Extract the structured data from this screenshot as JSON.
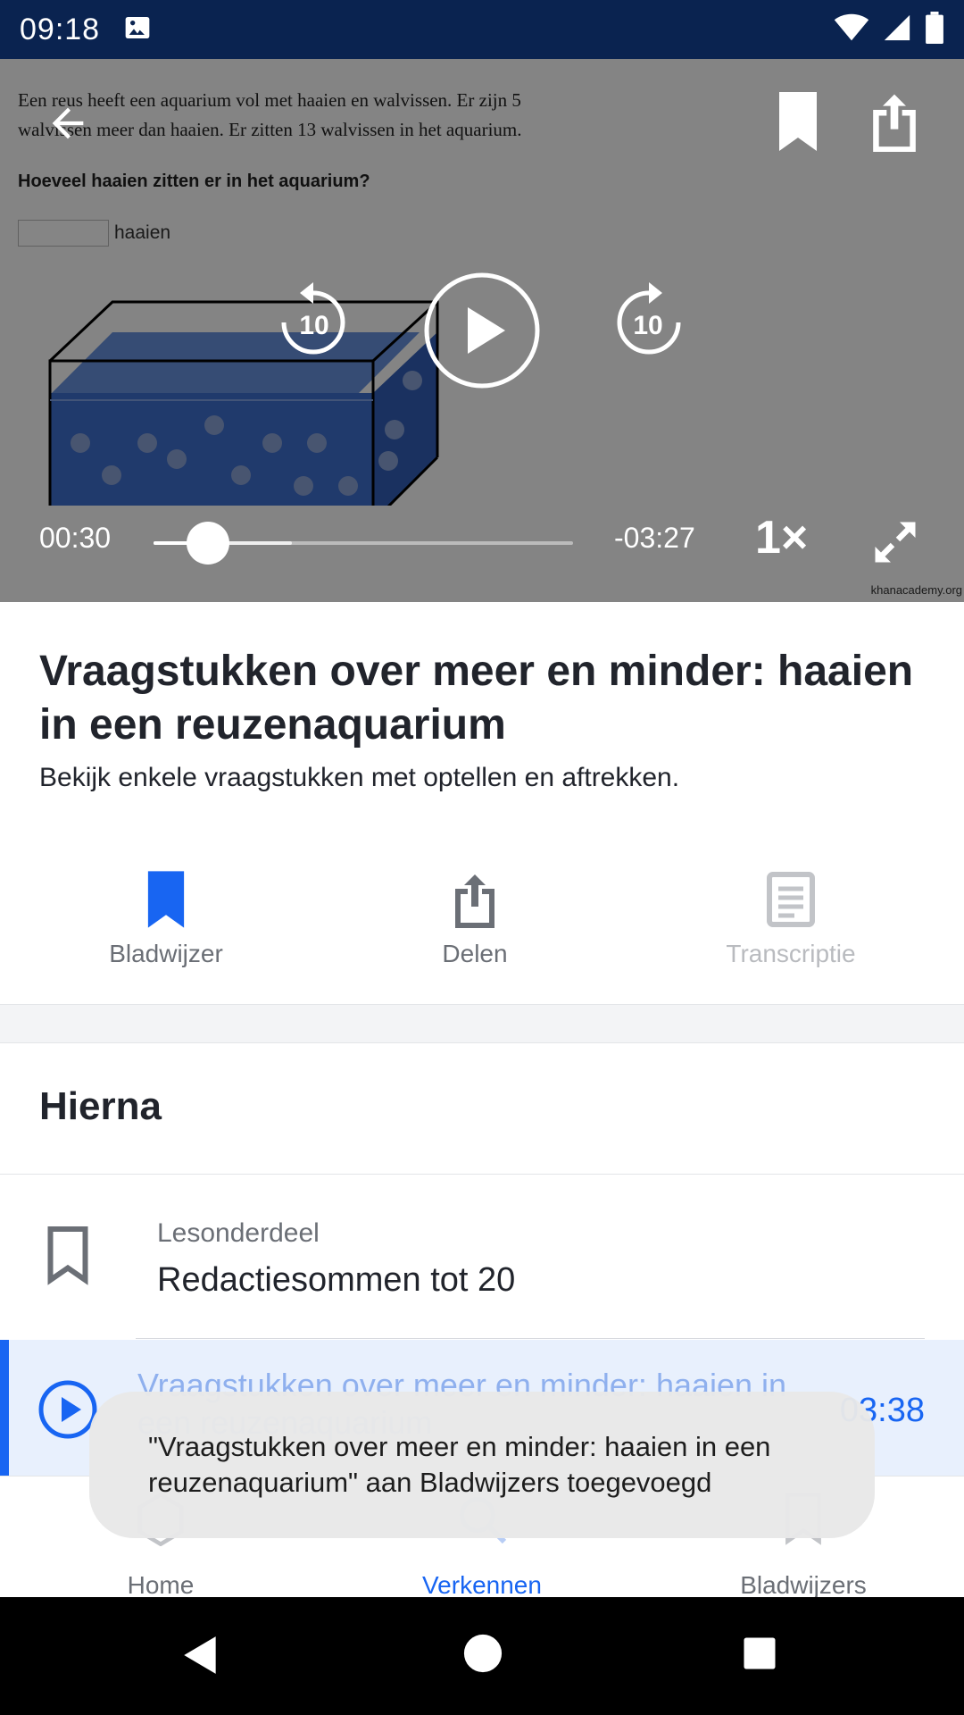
{
  "status_bar": {
    "time": "09:18"
  },
  "video": {
    "problem_line1": "Een reus heeft een aquarium vol met haaien en walvissen. Er zijn 5",
    "problem_line2": "walvissen meer dan haaien. Er zitten 13 walvissen in het aquarium.",
    "question": "Hoeveel haaien zitten er in het aquarium?",
    "answer_unit": "haaien",
    "watermark": "khanacademy.org",
    "rewind_label": "10",
    "forward_label": "10",
    "current_time": "00:30",
    "remaining_time": "-03:27",
    "speed": "1×",
    "progress": 0.13,
    "buffered": 0.33
  },
  "lesson": {
    "title": "Vraagstukken over meer en minder: haaien in een reuzenaquarium",
    "subtitle": "Bekijk enkele vraagstukken met optellen en aftrekken."
  },
  "actions": [
    {
      "label": "Bladwijzer",
      "icon": "bookmark-filled-icon"
    },
    {
      "label": "Delen",
      "icon": "share-icon"
    },
    {
      "label": "Transcriptie",
      "icon": "transcript-icon"
    }
  ],
  "up_next": {
    "heading": "Hierna",
    "unit_type": "Lesonderdeel",
    "unit_name": "Redactiesommen tot 20",
    "video_title": "Vraagstukken over meer en minder: haaien in een reuzenaquarium",
    "video_duration": "03:38"
  },
  "snackbar": {
    "message": "\"Vraagstukken over meer en minder: haaien in een reuzenaquarium\" aan Bladwijzers toegevoegd"
  },
  "bottom_nav": [
    {
      "label": "Home",
      "icon": "home-icon"
    },
    {
      "label": "Verkennen",
      "icon": "search-icon",
      "active": true
    },
    {
      "label": "Bladwijzers",
      "icon": "bookmark-icon"
    }
  ],
  "colors": {
    "status_bar": "#0a2350",
    "accent": "#1865f2",
    "text": "#21242c",
    "muted": "#6b6f76"
  }
}
